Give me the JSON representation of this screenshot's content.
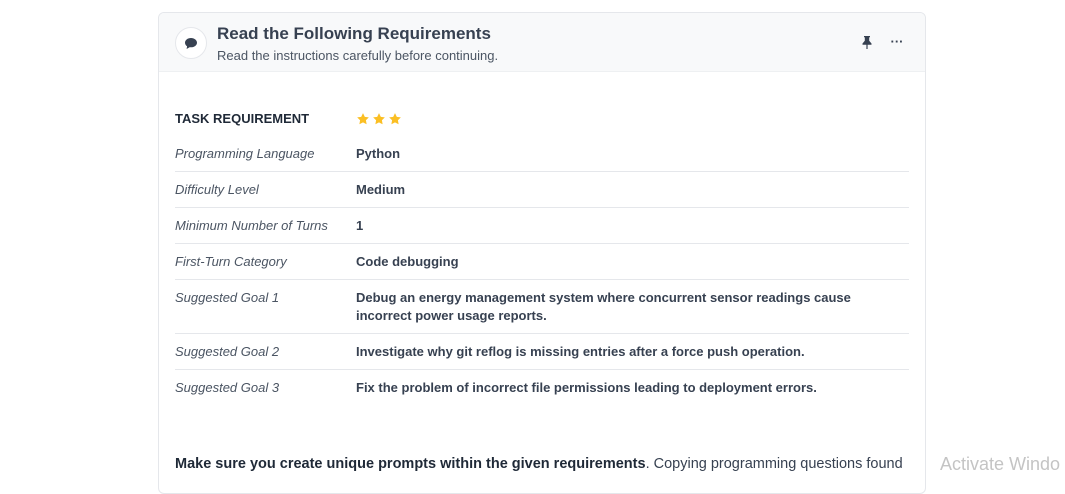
{
  "header": {
    "title": "Read the Following Requirements",
    "subtitle": "Read the instructions carefully before continuing.",
    "icon": "chat-bubble-icon",
    "pin_icon": "pin-icon",
    "more_label": "···"
  },
  "table": {
    "header_label": "TASK REQUIREMENT",
    "rating": {
      "stars": 3,
      "color": "#fbbf24"
    },
    "rows": [
      {
        "label": "Programming Language",
        "value": "Python"
      },
      {
        "label": "Difficulty Level",
        "value": "Medium"
      },
      {
        "label": "Minimum Number of Turns",
        "value": "1"
      },
      {
        "label": "First-Turn Category",
        "value": "Code debugging"
      },
      {
        "label": "Suggested Goal 1",
        "value": "Debug an energy management system where concurrent sensor readings cause incorrect power usage reports."
      },
      {
        "label": "Suggested Goal 2",
        "value": "Investigate why git reflog is missing entries after a force push operation."
      },
      {
        "label": "Suggested Goal 3",
        "value": "Fix the problem of incorrect file permissions leading to deployment errors."
      }
    ]
  },
  "footer": {
    "bold": "Make sure you create unique prompts within the given requirements",
    "rest": ". Copying programming questions found"
  },
  "watermark": "Activate Windo"
}
